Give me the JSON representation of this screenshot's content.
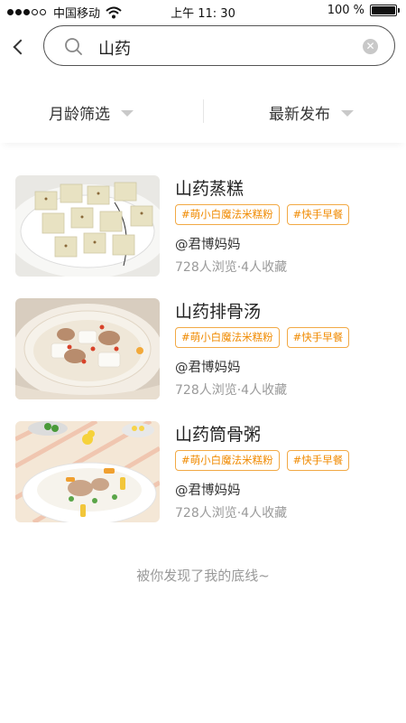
{
  "status_bar": {
    "carrier": "中国移动",
    "time": "上午 11: 30",
    "battery_text": "100 %",
    "battery_level": 1.0
  },
  "search": {
    "query": "山药",
    "icons": {
      "back": "chevron-left-icon",
      "search": "search-icon",
      "clear": "clear-icon"
    }
  },
  "filters": {
    "left_label": "月龄筛选",
    "right_label": "最新发布"
  },
  "recipes": [
    {
      "title": "山药蒸糕",
      "tags": [
        "#萌小白魔法米糕粉",
        "#快手早餐"
      ],
      "author": "@君博妈妈",
      "stats": "728人浏览·4人收藏"
    },
    {
      "title": "山药排骨汤",
      "tags": [
        "#萌小白魔法米糕粉",
        "#快手早餐"
      ],
      "author": "@君博妈妈",
      "stats": "728人浏览·4人收藏"
    },
    {
      "title": "山药筒骨粥",
      "tags": [
        "#萌小白魔法米糕粉",
        "#快手早餐"
      ],
      "author": "@君博妈妈",
      "stats": "728人浏览·4人收藏"
    }
  ],
  "footer": "被你发现了我的底线~",
  "colors": {
    "tag_border": "#f2a945",
    "tag_text": "#f08a00",
    "muted_text": "#9a9a9a"
  }
}
